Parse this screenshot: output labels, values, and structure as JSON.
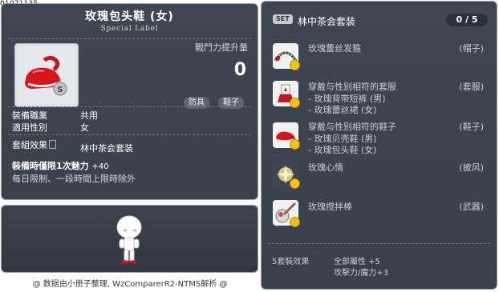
{
  "item_id": "01071135",
  "item": {
    "name": "玫瑰包头鞋 (女)",
    "label": "Special Label",
    "power_label": "戰鬥力提升量",
    "power_value": "0",
    "tags": [
      "防具",
      "鞋子"
    ]
  },
  "stats": {
    "job_label": "裝備職業",
    "job_value": "共用",
    "gender_label": "適用性別",
    "gender_value": "女",
    "set_label": "套組效果",
    "set_value": "林中茶会套装",
    "bonus_label": "裝備時僅限1次魅力",
    "bonus_value": "+40",
    "limit_note": "每日限制、一段時間上限時除外"
  },
  "footer": "@ 数据由小册子整理, WzComparerR2-NTMS解析 @",
  "set": {
    "badge": "SET",
    "title": "林中茶会套装",
    "count": "0 / 5",
    "items": [
      {
        "name": "玫瑰蕾丝发箍",
        "category": "(帽子)",
        "sub": []
      },
      {
        "name": "穿戴与性别相符的套服",
        "category": "(套服)",
        "sub": [
          "- 玫瑰背带短裤 (男)",
          "- 玫瑰蕾丝裙 (女)"
        ]
      },
      {
        "name": "穿戴与性别相符的鞋子",
        "category": "(鞋子)",
        "sub": [
          "- 玫瑰贝壳鞋 (男)",
          "- 玫瑰包头鞋 (女)"
        ]
      },
      {
        "name": "玫瑰心情",
        "category": "(披风)",
        "sub": []
      },
      {
        "name": "玫瑰搅拌棒",
        "category": "(武器)",
        "sub": []
      }
    ],
    "bonus_label": "5套裝效果",
    "bonus_lines": [
      "全部屬性 +5",
      "攻擊力/魔力+3"
    ]
  }
}
